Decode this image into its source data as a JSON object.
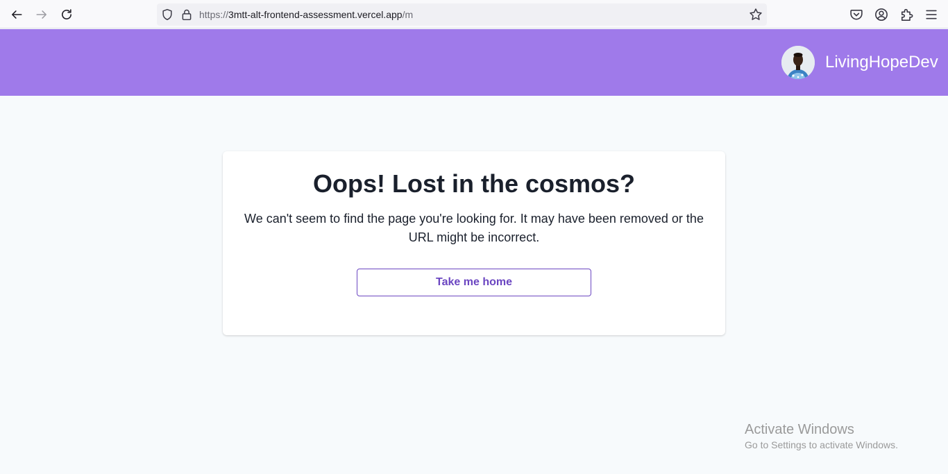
{
  "browser": {
    "url_prefix": "https://",
    "url_host": "3mtt-alt-frontend-assessment.vercel.app",
    "url_path": "/m",
    "icons": {
      "back": "arrow-left-icon",
      "forward": "arrow-right-icon",
      "reload": "reload-icon",
      "tracking_protection": "shield-icon",
      "secure": "lock-icon",
      "bookmark": "star-icon",
      "pocket": "pocket-icon",
      "account": "account-icon",
      "extensions": "puzzle-icon",
      "menu": "hamburger-menu-icon"
    }
  },
  "header": {
    "username": "LivingHopeDev",
    "background_color": "#9f7aea"
  },
  "error_card": {
    "title": "Oops! Lost in the cosmos?",
    "message": "We can't seem to find the page you're looking for. It may have been removed or the URL might be incorrect.",
    "button_label": "Take me home",
    "accent_color": "#6b46c1"
  },
  "watermark": {
    "title": "Activate Windows",
    "subtitle": "Go to Settings to activate Windows."
  }
}
